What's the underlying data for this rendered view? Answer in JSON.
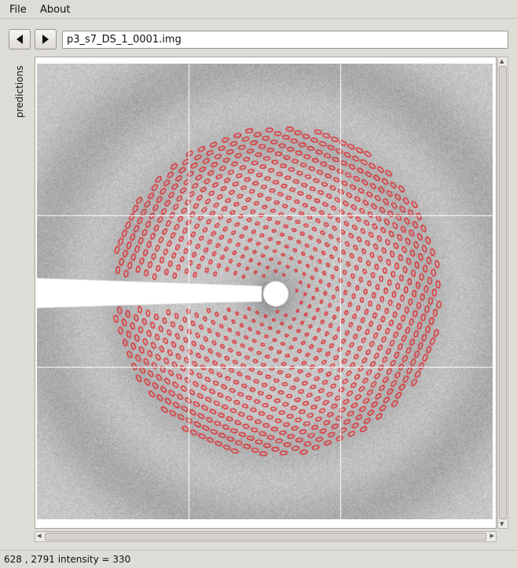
{
  "menubar": {
    "items": [
      "File",
      "About"
    ]
  },
  "toolbar": {
    "prev_icon": "arrow-left-icon",
    "next_icon": "arrow-right-icon",
    "file_value": "p3_s7_DS_1_0001.img"
  },
  "side_tab": {
    "label": "predictions"
  },
  "image_view": {
    "content": "x-ray diffraction pattern with predicted spot overlay",
    "colors": {
      "spot_outline": "#e0242a",
      "grid_lines": "#ffffff",
      "background_gray": "#c9c9c9"
    }
  },
  "statusbar": {
    "text": "628 , 2791  intensity = 330"
  }
}
